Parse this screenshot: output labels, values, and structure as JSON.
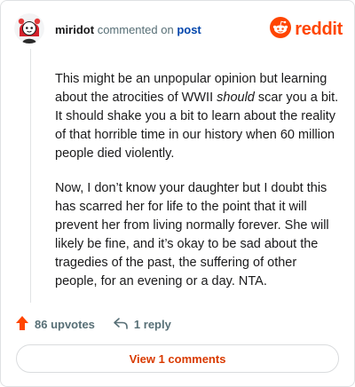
{
  "header": {
    "username": "miridot",
    "action_text": "commented on",
    "post_link": "post",
    "brand_name": "reddit"
  },
  "comment": {
    "paragraph1_before": "This might be an unpopular opinion but learning about the atrocities of WWII ",
    "paragraph1_emphasis": "should",
    "paragraph1_after": " scar you a bit. It should shake you a bit to learn about the reality of that horrible time in our history when 60 million people died violently.",
    "paragraph2": "Now, I don’t know your daughter but I doubt this has scarred her for life to the point that it will prevent her from living normally forever. She will likely be fine, and it’s okay to be sad about the tragedies of the past, the suffering of other people, for an evening or a day. NTA."
  },
  "actions": {
    "upvotes": "86 upvotes",
    "replies": "1 reply"
  },
  "footer": {
    "view_comments": "View 1 comments"
  },
  "colors": {
    "brand": "#ff4500",
    "link": "#0045ac",
    "view_button_text": "#d93a00",
    "muted_text": "#576f76"
  },
  "icons": [
    "user-avatar",
    "reddit-logo-icon",
    "upvote-arrow-icon",
    "reply-arrow-icon"
  ]
}
